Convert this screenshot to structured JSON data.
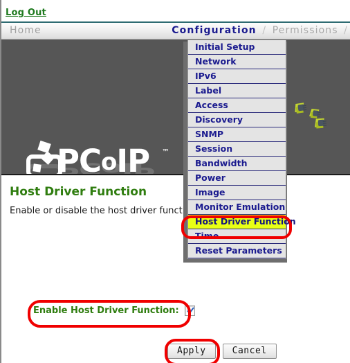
{
  "topbar": {
    "logout_label": "Log Out"
  },
  "nav": {
    "home_label": "Home",
    "active_label": "Configuration",
    "separator": "/",
    "second_label": "Permissions",
    "trailing_separator": "/"
  },
  "banner": {
    "logo_text": "PC",
    "logo_o": "o",
    "logo_ip": "IP",
    "logo_tm": "™",
    "logo_alt": "pcoip-logo"
  },
  "menu": {
    "items": [
      {
        "label": "Initial Setup",
        "selected": false
      },
      {
        "label": "Network",
        "selected": false
      },
      {
        "label": "IPv6",
        "selected": false
      },
      {
        "label": "Label",
        "selected": false
      },
      {
        "label": "Access",
        "selected": false
      },
      {
        "label": "Discovery",
        "selected": false
      },
      {
        "label": "SNMP",
        "selected": false
      },
      {
        "label": "Session",
        "selected": false
      },
      {
        "label": "Bandwidth",
        "selected": false
      },
      {
        "label": "Power",
        "selected": false
      },
      {
        "label": "Image",
        "selected": false
      },
      {
        "label": "Monitor Emulation",
        "selected": false
      },
      {
        "label": "Host Driver Function",
        "selected": true
      },
      {
        "label": "Time",
        "selected": false
      },
      {
        "label": "Reset Parameters",
        "selected": false
      }
    ]
  },
  "main": {
    "title": "Host Driver Function",
    "description": "Enable or disable the host driver function",
    "checkbox_label": "Enable Host Driver Function:",
    "checkbox_checked": true,
    "apply_label": "Apply",
    "cancel_label": "Cancel"
  },
  "colors": {
    "green_heading": "#2f7d0f",
    "nav_active_blue": "#1b1b8f",
    "menu_highlight": "#e8ff14",
    "annotation_red": "#f00000",
    "banner_bg": "#565656"
  }
}
